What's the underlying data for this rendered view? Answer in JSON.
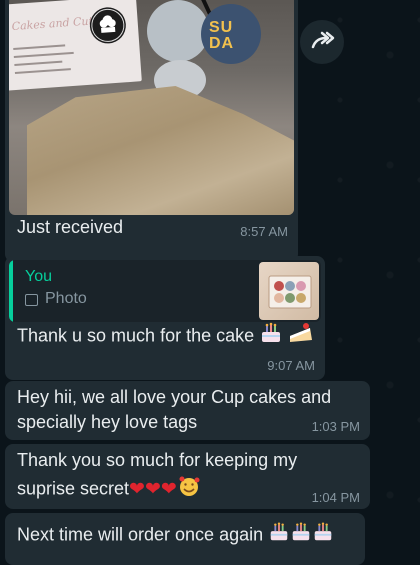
{
  "forward_icon": "forward-icon",
  "image_message": {
    "caption": "Just received",
    "time": "8:57 AM",
    "photo_card_title": "Cakes and Cuts",
    "photo_tag": "SU DA"
  },
  "reply_message": {
    "quoted_sender": "You",
    "quoted_type": "Photo",
    "text": "Thank u so much for the cake",
    "emojis": [
      "birthday-cake",
      "cake-slice"
    ],
    "time": "9:07 AM"
  },
  "messages": [
    {
      "lines": [
        "Hey hii, we all love your Cup cakes and",
        "specially hey love tags"
      ],
      "time": "1:03 PM"
    },
    {
      "lines": [
        "Thank you so much for keeping my",
        "suprise secret"
      ],
      "emojis": [
        "red-heart",
        "red-heart",
        "red-heart",
        "smiling-face-with-hearts"
      ],
      "time": "1:04 PM"
    },
    {
      "lines": [
        "Next time will order once again"
      ],
      "emojis": [
        "birthday-cake",
        "birthday-cake",
        "birthday-cake"
      ]
    }
  ],
  "colors": {
    "background": "#0b141a",
    "bubble": "#202c33",
    "accent": "#06cf9c",
    "timestamp": "#8696a0"
  }
}
